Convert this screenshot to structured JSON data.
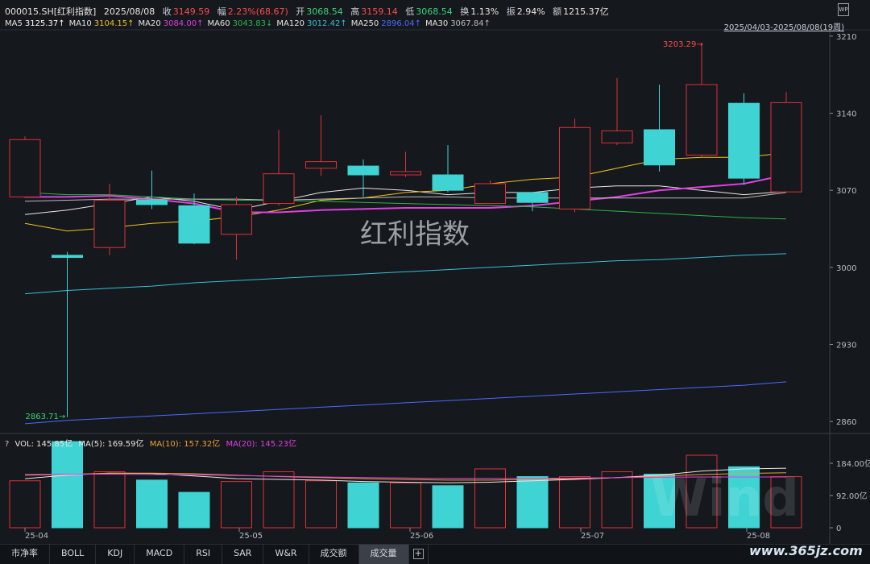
{
  "header": {
    "code": "000015.SH[红利指数]",
    "date": "2025/08/08",
    "close_label": "收",
    "close": "3149.59",
    "change_label": "幅",
    "change": "2.23%(68.67)",
    "open_label": "开",
    "open": "3068.54",
    "high_label": "高",
    "high": "3159.14",
    "low_label": "低",
    "low": "3068.54",
    "turnover_label": "换",
    "turnover": "1.13%",
    "amp_label": "振",
    "amp": "2.94%",
    "amount_label": "额",
    "amount": "1215.37亿"
  },
  "ma_line": [
    {
      "label": "MA5",
      "value": "3125.37↑",
      "color": "#ffffff"
    },
    {
      "label": "MA10",
      "value": "3104.15↑",
      "color": "#f0c419"
    },
    {
      "label": "MA20",
      "value": "3084.00↑",
      "color": "#e040e0"
    },
    {
      "label": "MA60",
      "value": "3043.83↓",
      "color": "#2db34a"
    },
    {
      "label": "MA120",
      "value": "3012.42↑",
      "color": "#36c1d4"
    },
    {
      "label": "MA250",
      "value": "2896.04↑",
      "color": "#4b6bff"
    },
    {
      "label": "MA30",
      "value": "3067.84↑",
      "color": "#bbbbbb"
    }
  ],
  "range_label": "2025/04/03-2025/08/08(19周)",
  "wp_icon": "WP",
  "watermark_title": "红利指数",
  "vol_info": {
    "q": "?",
    "vol": "VOL: 145.85亿",
    "ma5": "MA(5): 169.59亿",
    "ma10": "MA(10): 157.32亿",
    "ma20": "MA(20): 145.23亿"
  },
  "tabs": [
    "市净率",
    "BOLL",
    "KDJ",
    "MACD",
    "RSI",
    "SAR",
    "W&R",
    "成交额",
    "成交量"
  ],
  "active_tab": "成交量",
  "site_watermark": "www.365jz.com",
  "wind_watermark": "Wind",
  "chart_data": {
    "type": "candlestick",
    "x_labels": [
      "25-04",
      "25-05",
      "25-06",
      "25-07",
      "25-08"
    ],
    "y_ticks": [
      2860,
      2930,
      3000,
      3070,
      3140,
      3210
    ],
    "ylim": [
      2855,
      3215
    ],
    "annotations": [
      {
        "text": "3203.29→",
        "value": 3203.29,
        "candle": 16
      },
      {
        "text": "2863.71→",
        "value": 2863.71,
        "candle": 1
      }
    ],
    "candles": [
      {
        "o": 3064,
        "h": 3119,
        "l": 3063,
        "c": 3116,
        "up": true
      },
      {
        "o": 3011,
        "h": 3014,
        "l": 2864,
        "c": 3009,
        "up": false
      },
      {
        "o": 3018,
        "h": 3076,
        "l": 3011,
        "c": 3061,
        "up": true
      },
      {
        "o": 3061,
        "h": 3088,
        "l": 3053,
        "c": 3057,
        "up": false
      },
      {
        "o": 3056,
        "h": 3067,
        "l": 3021,
        "c": 3022,
        "up": false
      },
      {
        "o": 3030,
        "h": 3064,
        "l": 3007,
        "c": 3057,
        "up": true
      },
      {
        "o": 3058,
        "h": 3125,
        "l": 3056,
        "c": 3085,
        "up": true
      },
      {
        "o": 3090,
        "h": 3138,
        "l": 3083,
        "c": 3096,
        "up": true
      },
      {
        "o": 3092,
        "h": 3098,
        "l": 3064,
        "c": 3084,
        "up": false
      },
      {
        "o": 3084,
        "h": 3105,
        "l": 3082,
        "c": 3087,
        "up": true
      },
      {
        "o": 3084,
        "h": 3111,
        "l": 3068,
        "c": 3070,
        "up": false
      },
      {
        "o": 3058,
        "h": 3079,
        "l": 3059,
        "c": 3076,
        "up": true
      },
      {
        "o": 3068,
        "h": 3068,
        "l": 3051,
        "c": 3059,
        "up": false
      },
      {
        "o": 3053,
        "h": 3135,
        "l": 3050,
        "c": 3127,
        "up": true
      },
      {
        "o": 3113,
        "h": 3172,
        "l": 3111,
        "c": 3124,
        "up": true
      },
      {
        "o": 3125,
        "h": 3166,
        "l": 3087,
        "c": 3093,
        "up": false
      },
      {
        "o": 3102,
        "h": 3203.29,
        "l": 3100,
        "c": 3166,
        "up": true
      },
      {
        "o": 3149,
        "h": 3158,
        "l": 3075,
        "c": 3081,
        "up": false
      },
      {
        "o": 3068.54,
        "h": 3159.14,
        "l": 3068.54,
        "c": 3149.59,
        "up": true
      }
    ],
    "ma_series": [
      {
        "name": "MA5",
        "color": "#e8e8e8",
        "values": [
          3048,
          3052,
          3058,
          3064,
          3060,
          3052,
          3060,
          3068,
          3072,
          3070,
          3066,
          3068,
          3068,
          3072,
          3074,
          3074,
          3070,
          3066,
          3069
        ]
      },
      {
        "name": "MA10",
        "color": "#f0c419",
        "values": [
          3040,
          3033,
          3036,
          3040,
          3042,
          3046,
          3052,
          3061,
          3063,
          3068,
          3070,
          3076,
          3080,
          3082,
          3090,
          3098,
          3100,
          3100,
          3104
        ]
      },
      {
        "name": "MA20",
        "color": "#e040e0",
        "values": [
          3064,
          3064,
          3065,
          3062,
          3058,
          3050,
          3050,
          3052,
          3053,
          3054,
          3054,
          3054,
          3056,
          3060,
          3064,
          3070,
          3073,
          3076,
          3084
        ]
      },
      {
        "name": "MA60",
        "color": "#2db34a",
        "values": [
          3068,
          3066,
          3066,
          3064,
          3062,
          3061,
          3061,
          3060,
          3059,
          3058,
          3057,
          3056,
          3055,
          3053,
          3051,
          3049,
          3047,
          3045,
          3044
        ]
      },
      {
        "name": "MA30",
        "color": "#bbbbbb",
        "values": [
          3060,
          3061,
          3062,
          3062,
          3062,
          3062,
          3061,
          3062,
          3063,
          3064,
          3064,
          3063,
          3063,
          3063,
          3063,
          3063,
          3063,
          3063,
          3068
        ]
      },
      {
        "name": "MA120",
        "color": "#36c1d4",
        "values": [
          2976,
          2979,
          2981,
          2983,
          2986,
          2988,
          2990,
          2992,
          2994,
          2996,
          2998,
          3000,
          3002,
          3004,
          3006,
          3007,
          3009,
          3011,
          3012.42
        ]
      },
      {
        "name": "MA250",
        "color": "#4b6bff",
        "values": [
          2858,
          2861,
          2863,
          2865,
          2867,
          2869,
          2871,
          2873,
          2875,
          2877,
          2879,
          2881,
          2883,
          2885,
          2887,
          2889,
          2891,
          2893,
          2896.04
        ]
      }
    ],
    "volume": {
      "unit": "亿",
      "y_ticks": [
        0,
        92,
        184
      ],
      "y_tick_labels": [
        "0",
        "92.00亿",
        "184.00亿"
      ],
      "ylim": [
        0,
        230
      ],
      "values": [
        134,
        246,
        160,
        136,
        101,
        132,
        160,
        134,
        128,
        128,
        120,
        168,
        146,
        146,
        160,
        153,
        207,
        174,
        145.85
      ],
      "ma5": [
        140,
        150,
        156,
        155,
        148,
        140,
        138,
        136,
        132,
        130,
        128,
        130,
        134,
        138,
        143,
        150,
        162,
        168,
        170
      ],
      "ma10": [
        150,
        152,
        156,
        156,
        154,
        150,
        146,
        143,
        140,
        138,
        136,
        136,
        138,
        140,
        143,
        147,
        152,
        155,
        157
      ],
      "ma20": [
        152,
        153,
        153,
        152,
        151,
        149,
        147,
        145,
        143,
        142,
        141,
        141,
        141,
        142,
        143,
        144,
        145,
        145,
        145
      ]
    }
  }
}
